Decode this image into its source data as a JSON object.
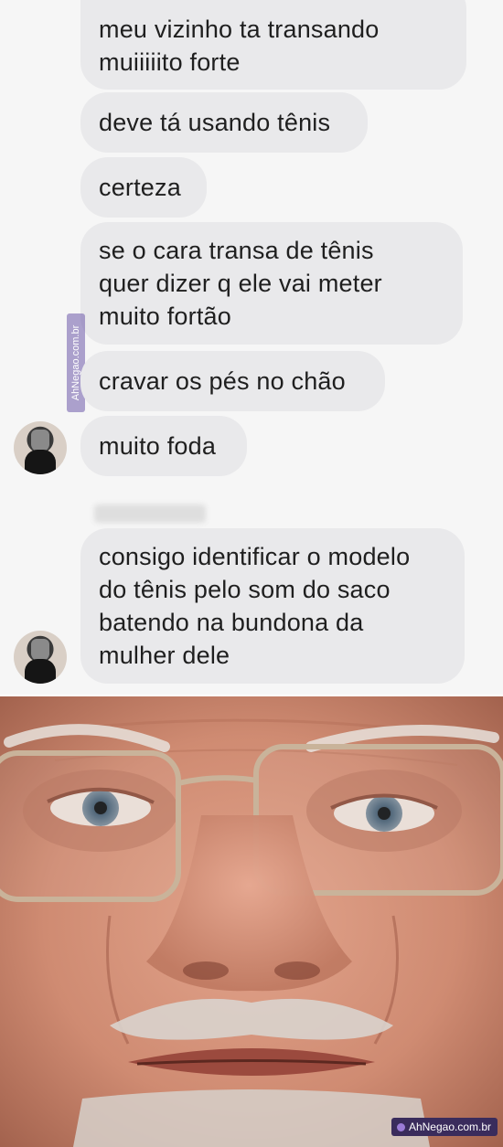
{
  "messages": [
    {
      "lines": [
        "meu vizinho ta transando",
        "muiiiiito forte"
      ]
    },
    {
      "lines": [
        "deve tá usando tênis"
      ]
    },
    {
      "lines": [
        "certeza"
      ]
    },
    {
      "lines": [
        "se o cara transa de tênis",
        "quer dizer q ele vai meter",
        "muito fortão"
      ]
    },
    {
      "lines": [
        "cravar os pés no chão"
      ]
    },
    {
      "lines": [
        "muito foda"
      ]
    },
    {
      "lines": [
        "consigo identificar o modelo",
        "do tênis pelo som do saco",
        "batendo na bundona da",
        "mulher dele"
      ]
    }
  ],
  "side_watermark": "AhNegao.com.br",
  "watermark": "AhNegao.com.br",
  "colors": {
    "bubble": "#e9e9eb",
    "chat_bg": "#f6f6f6",
    "watermark_bg": "#3a2c5c"
  }
}
